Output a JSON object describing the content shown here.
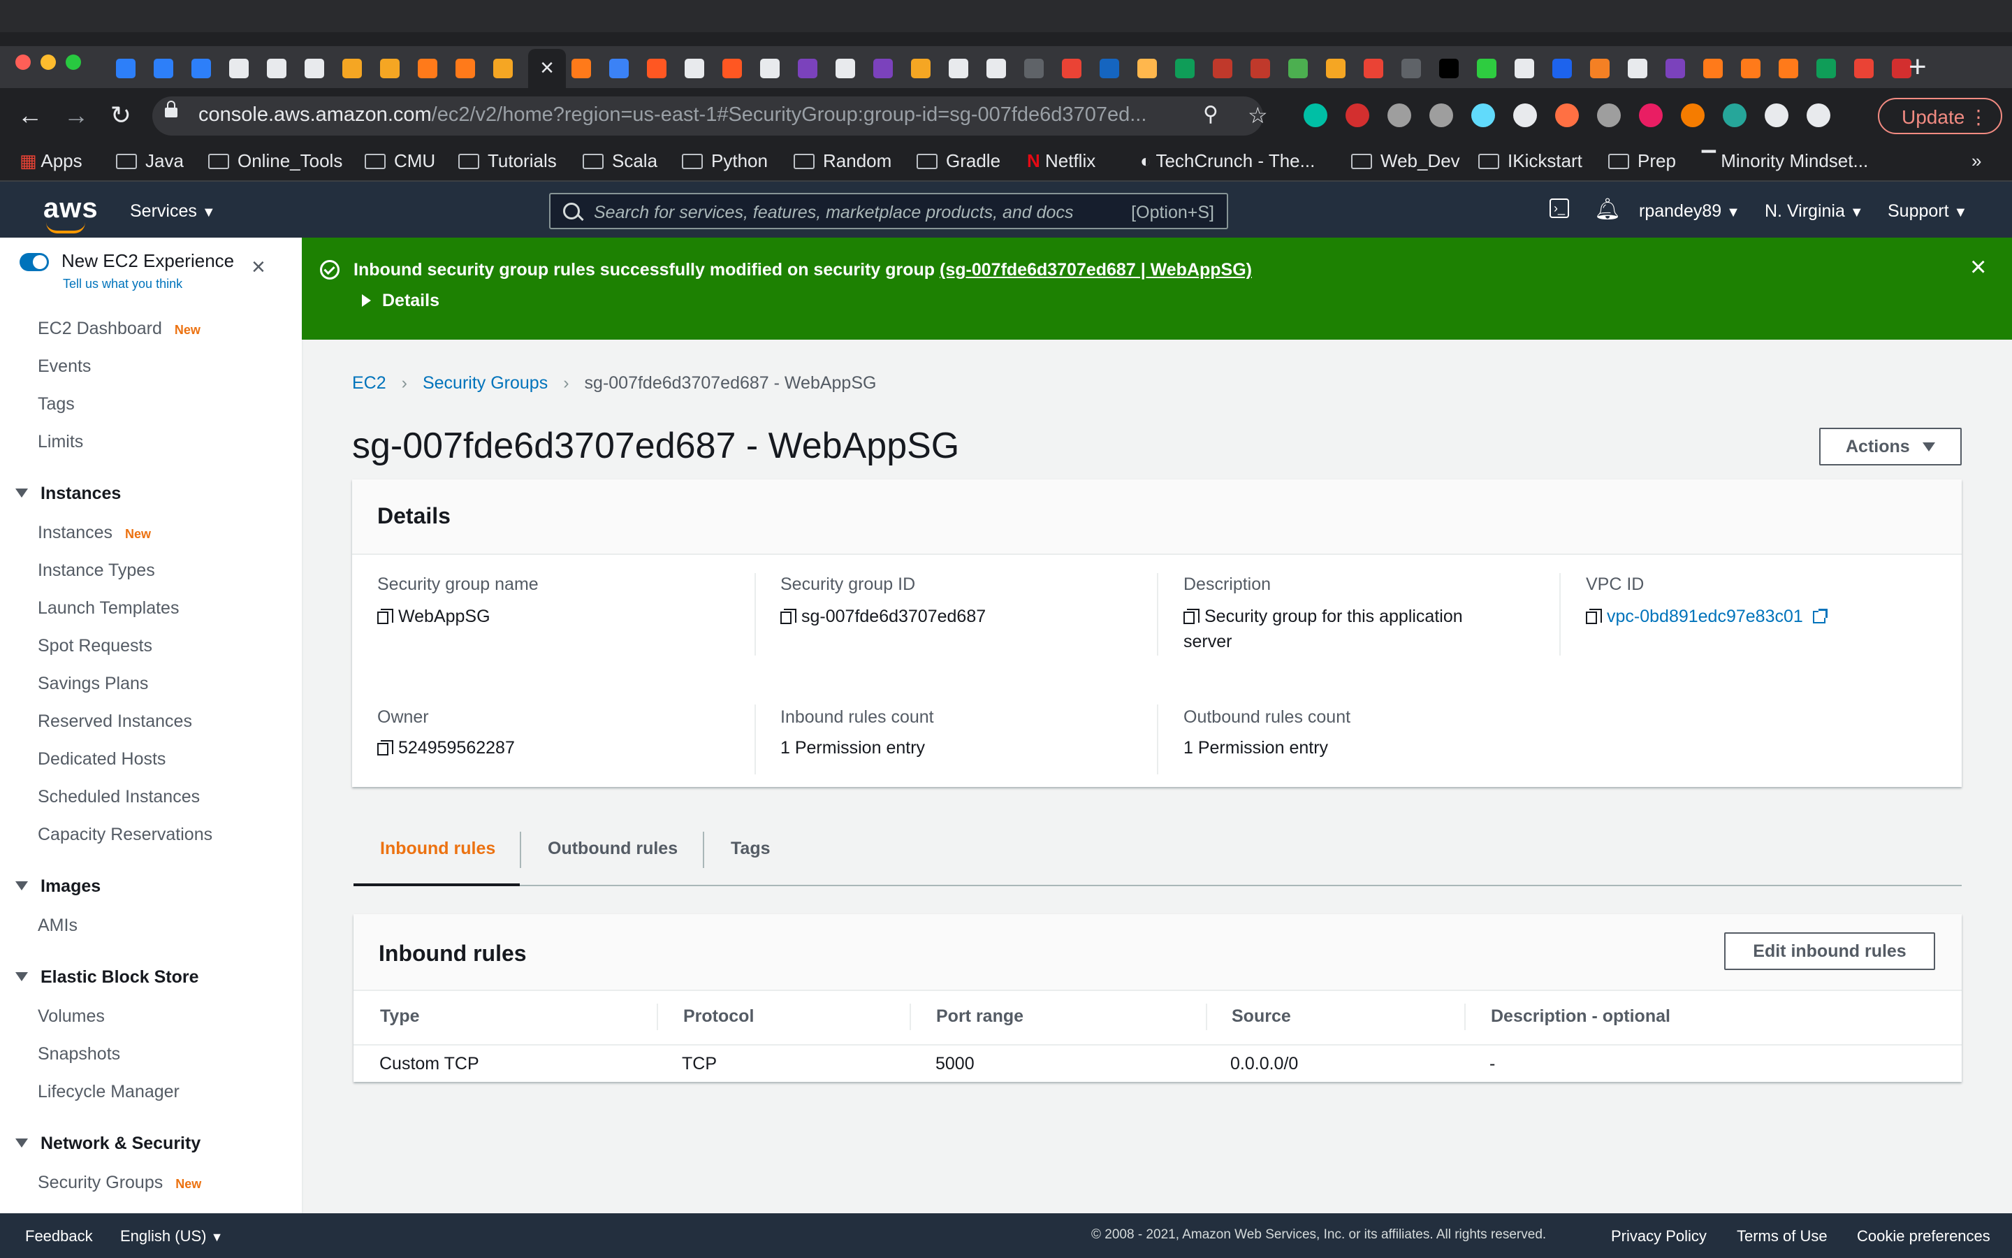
{
  "browser": {
    "url_host": "console.aws.amazon.com",
    "url_path": "/ec2/v2/home?region=us-east-1#SecurityGroup:group-id=sg-007fde6d3707ed...",
    "update_label": "Update",
    "tab_icon_colors": [
      "#2d7ff9",
      "#2d7ff9",
      "#2d7ff9",
      "#e8eaed",
      "#e8eaed",
      "#e8eaed",
      "#f5a623",
      "#f5a623",
      "#ff7a1a",
      "#ff7a1a",
      "#f5a623",
      "#ff7a1a",
      "#3b82f6",
      "#ff5722",
      "#e8eaed",
      "#ff5722",
      "#e8eaed",
      "#7b42bc",
      "#e8eaed",
      "#7b42bc",
      "#f5a623",
      "#e8eaed",
      "#e8eaed",
      "#5f6368",
      "#ea4335",
      "#1565c0",
      "#ffb74d",
      "#0f9d58",
      "#c0392b",
      "#c0392b",
      "#4caf50",
      "#f5a623",
      "#ea4335",
      "#5f6368",
      "#000000",
      "#2ecc40",
      "#e8eaed",
      "#1d63ed",
      "#f48024",
      "#e8eaed",
      "#7b42bc",
      "#ff7a1a",
      "#ff7a1a",
      "#ff7a1a",
      "#0f9d58",
      "#ea4335",
      "#d32f2f"
    ],
    "extension_colors": [
      "#00bfa5",
      "#d32f2f",
      "#9e9e9e",
      "#9e9e9e",
      "#61dafb",
      "#e8eaed",
      "#ff7043",
      "#9e9e9e",
      "#e91e63",
      "#f57c00",
      "#26a69a",
      "#e8eaed",
      "#e8eaed"
    ],
    "bookmarks": [
      {
        "label": "Apps",
        "icon": "apps-grid-icon"
      },
      {
        "label": "Java",
        "icon": "folder-icon"
      },
      {
        "label": "Online_Tools",
        "icon": "folder-icon"
      },
      {
        "label": "CMU",
        "icon": "folder-icon"
      },
      {
        "label": "Tutorials",
        "icon": "folder-icon"
      },
      {
        "label": "Scala",
        "icon": "folder-icon"
      },
      {
        "label": "Python",
        "icon": "folder-icon"
      },
      {
        "label": "Random",
        "icon": "folder-icon"
      },
      {
        "label": "Gradle",
        "icon": "folder-icon"
      },
      {
        "label": "Netflix",
        "icon": "netflix-icon"
      },
      {
        "label": "TechCrunch - The...",
        "icon": "globe-icon"
      },
      {
        "label": "Web_Dev",
        "icon": "folder-icon"
      },
      {
        "label": "IKickstart",
        "icon": "folder-icon"
      },
      {
        "label": "Prep",
        "icon": "folder-icon"
      },
      {
        "label": "Minority Mindset...",
        "icon": "bookmark-icon"
      }
    ],
    "bookmarks_overflow": "»"
  },
  "aws_header": {
    "logo": "aws",
    "services_label": "Services",
    "search_placeholder": "Search for services, features, marketplace products, and docs",
    "search_shortcut": "[Option+S]",
    "user": "rpandey89",
    "region": "N. Virginia",
    "support": "Support"
  },
  "sidebar": {
    "new_experience_title": "New EC2 Experience",
    "new_experience_link": "Tell us what you think",
    "new_badge": "New",
    "top_items": [
      {
        "label": "EC2 Dashboard",
        "new": true
      },
      {
        "label": "Events",
        "new": false
      },
      {
        "label": "Tags",
        "new": false
      },
      {
        "label": "Limits",
        "new": false
      }
    ],
    "sections": [
      {
        "title": "Instances",
        "items": [
          {
            "label": "Instances",
            "new": true
          },
          {
            "label": "Instance Types",
            "new": false
          },
          {
            "label": "Launch Templates",
            "new": false
          },
          {
            "label": "Spot Requests",
            "new": false
          },
          {
            "label": "Savings Plans",
            "new": false
          },
          {
            "label": "Reserved Instances",
            "new": false
          },
          {
            "label": "Dedicated Hosts",
            "new": false
          },
          {
            "label": "Scheduled Instances",
            "new": false
          },
          {
            "label": "Capacity Reservations",
            "new": false
          }
        ]
      },
      {
        "title": "Images",
        "items": [
          {
            "label": "AMIs",
            "new": false
          }
        ]
      },
      {
        "title": "Elastic Block Store",
        "items": [
          {
            "label": "Volumes",
            "new": false
          },
          {
            "label": "Snapshots",
            "new": false
          },
          {
            "label": "Lifecycle Manager",
            "new": false
          }
        ]
      },
      {
        "title": "Network & Security",
        "items": [
          {
            "label": "Security Groups",
            "new": true
          }
        ]
      }
    ]
  },
  "flash": {
    "message": "Inbound security group rules successfully modified on security group ",
    "link": "(sg-007fde6d3707ed687 | WebAppSG)",
    "details": "Details"
  },
  "breadcrumb": {
    "items": [
      "EC2",
      "Security Groups"
    ],
    "current": "sg-007fde6d3707ed687 - WebAppSG"
  },
  "page": {
    "title": "sg-007fde6d3707ed687 - WebAppSG",
    "actions_label": "Actions"
  },
  "details": {
    "heading": "Details",
    "fields": {
      "sg_name": {
        "label": "Security group name",
        "value": "WebAppSG"
      },
      "sg_id": {
        "label": "Security group ID",
        "value": "sg-007fde6d3707ed687"
      },
      "description": {
        "label": "Description",
        "value_line1": "Security group for this application",
        "value_line2": "server"
      },
      "vpc_id": {
        "label": "VPC ID",
        "value": "vpc-0bd891edc97e83c01"
      },
      "owner": {
        "label": "Owner",
        "value": "524959562287"
      },
      "inbound_count": {
        "label": "Inbound rules count",
        "value": "1 Permission entry"
      },
      "outbound_count": {
        "label": "Outbound rules count",
        "value": "1 Permission entry"
      }
    }
  },
  "tabs": [
    "Inbound rules",
    "Outbound rules",
    "Tags"
  ],
  "inbound": {
    "heading": "Inbound rules",
    "edit_label": "Edit inbound rules",
    "columns": [
      "Type",
      "Protocol",
      "Port range",
      "Source",
      "Description - optional"
    ],
    "rows": [
      [
        "Custom TCP",
        "TCP",
        "5000",
        "0.0.0.0/0",
        "-"
      ]
    ]
  },
  "footer": {
    "feedback": "Feedback",
    "language": "English (US)",
    "copyright": "© 2008 - 2021, Amazon Web Services, Inc. or its affiliates. All rights reserved.",
    "privacy": "Privacy Policy",
    "terms": "Terms of Use",
    "cookies": "Cookie preferences"
  },
  "colors": {
    "aws_nav": "#232f3e",
    "success_green": "#1d8102",
    "link_blue": "#0073bb",
    "orange_accent": "#ec7211"
  }
}
